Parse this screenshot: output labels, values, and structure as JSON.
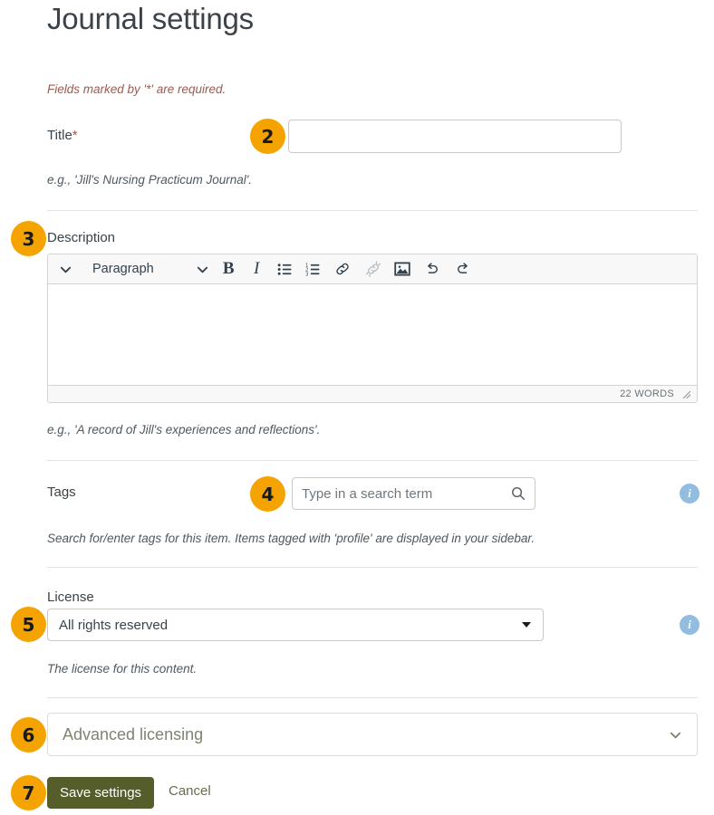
{
  "page": {
    "title": "Journal settings",
    "required_note": "Fields marked by '*' are required."
  },
  "fields": {
    "title": {
      "label": "Title",
      "required_marker": "*",
      "value": "",
      "placeholder": "",
      "help": "e.g., 'Jill's Nursing Practicum Journal'.",
      "step": "2"
    },
    "description": {
      "label": "Description",
      "value": "",
      "help": "e.g., 'A record of Jill's experiences and reflections'.",
      "step": "3",
      "word_count": "22 WORDS",
      "toolbar": {
        "collapse_icon": "chevron-down-icon",
        "format_label": "Paragraph",
        "format_caret_icon": "chevron-down-icon",
        "buttons": [
          {
            "name": "bold",
            "glyph": "B"
          },
          {
            "name": "italic",
            "glyph": "I"
          },
          {
            "name": "bullet-list",
            "glyph": "bullet-list-icon"
          },
          {
            "name": "numbered-list",
            "glyph": "numbered-list-icon"
          },
          {
            "name": "link",
            "glyph": "link-icon"
          },
          {
            "name": "unlink",
            "glyph": "unlink-icon"
          },
          {
            "name": "image",
            "glyph": "image-icon"
          },
          {
            "name": "undo",
            "glyph": "undo-icon"
          },
          {
            "name": "redo",
            "glyph": "redo-icon"
          }
        ]
      }
    },
    "tags": {
      "label": "Tags",
      "value": "",
      "placeholder": "Type in a search term",
      "help": "Search for/enter tags for this item. Items tagged with 'profile' are displayed in your sidebar.",
      "step": "4",
      "search_icon": "search-icon",
      "info_icon": "info-icon"
    },
    "license": {
      "label": "License",
      "selected": "All rights reserved",
      "help": "The license for this content.",
      "step": "5",
      "info_icon": "info-icon"
    },
    "advanced_licensing": {
      "label": "Advanced licensing",
      "step": "6",
      "chevron_icon": "chevron-down-icon"
    }
  },
  "actions": {
    "save_label": "Save settings",
    "cancel_label": "Cancel",
    "step": "7"
  },
  "colors": {
    "badge": "#f5a300",
    "save_button": "#555e2b",
    "required_text": "#9b5b52",
    "info_icon": "#92bde0"
  }
}
